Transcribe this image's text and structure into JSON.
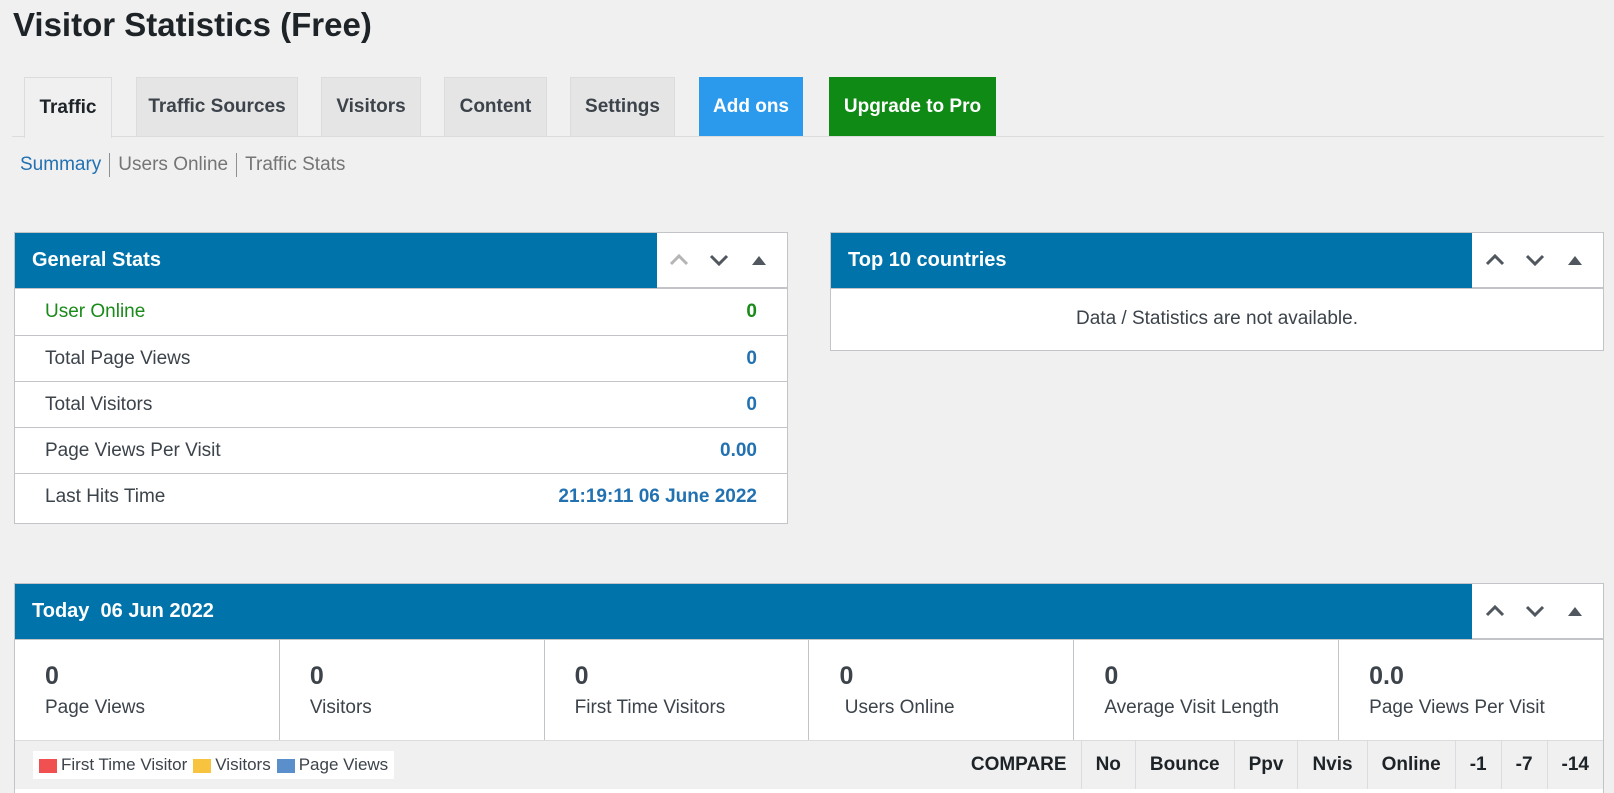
{
  "page": {
    "title": "Visitor Statistics (Free)"
  },
  "tabs": [
    {
      "label": "Traffic"
    },
    {
      "label": "Traffic Sources"
    },
    {
      "label": "Visitors"
    },
    {
      "label": "Content"
    },
    {
      "label": "Settings"
    },
    {
      "label": "Add ons"
    },
    {
      "label": "Upgrade to Pro"
    }
  ],
  "subnav": [
    "Summary",
    "Users Online",
    "Traffic Stats"
  ],
  "general_stats": {
    "title": "General Stats",
    "rows": [
      {
        "label": "User Online",
        "value": "0"
      },
      {
        "label": "Total Page Views",
        "value": "0"
      },
      {
        "label": "Total Visitors",
        "value": "0"
      },
      {
        "label": "Page Views Per Visit",
        "value": "0.00"
      },
      {
        "label": "Last Hits Time",
        "value": "21:19:11 06 June 2022"
      }
    ]
  },
  "top_countries": {
    "title": "Top 10 countries",
    "empty_message": "Data / Statistics are not available."
  },
  "today": {
    "title": "Today  06 Jun 2022",
    "stats": [
      {
        "value": "0",
        "label": "Page Views"
      },
      {
        "value": "0",
        "label": "Visitors"
      },
      {
        "value": "0",
        "label": "First Time Visitors"
      },
      {
        "value": "0",
        "label": " Users Online"
      },
      {
        "value": "0",
        "label": "Average Visit Length"
      },
      {
        "value": "0.0",
        "label": "Page Views Per Visit"
      }
    ],
    "legend": [
      {
        "label": "First Time Visitor",
        "color": "#f05050"
      },
      {
        "label": "Visitors",
        "color": "#f8c440"
      },
      {
        "label": "Page Views",
        "color": "#5b8fcb"
      }
    ],
    "compare": [
      "COMPARE",
      "No",
      "Bounce",
      "Ppv",
      "Nvis",
      "Online",
      "-1",
      "-7",
      "-14"
    ]
  },
  "colors": {
    "header_blue": "#0073aa",
    "addons_blue": "#2b9aec",
    "pro_green": "#0f8a15",
    "link_blue": "#2271b1",
    "online_green": "#1a8a1a"
  },
  "icons": [
    "chevron-up-icon",
    "chevron-down-icon",
    "triangle-up-icon"
  ]
}
